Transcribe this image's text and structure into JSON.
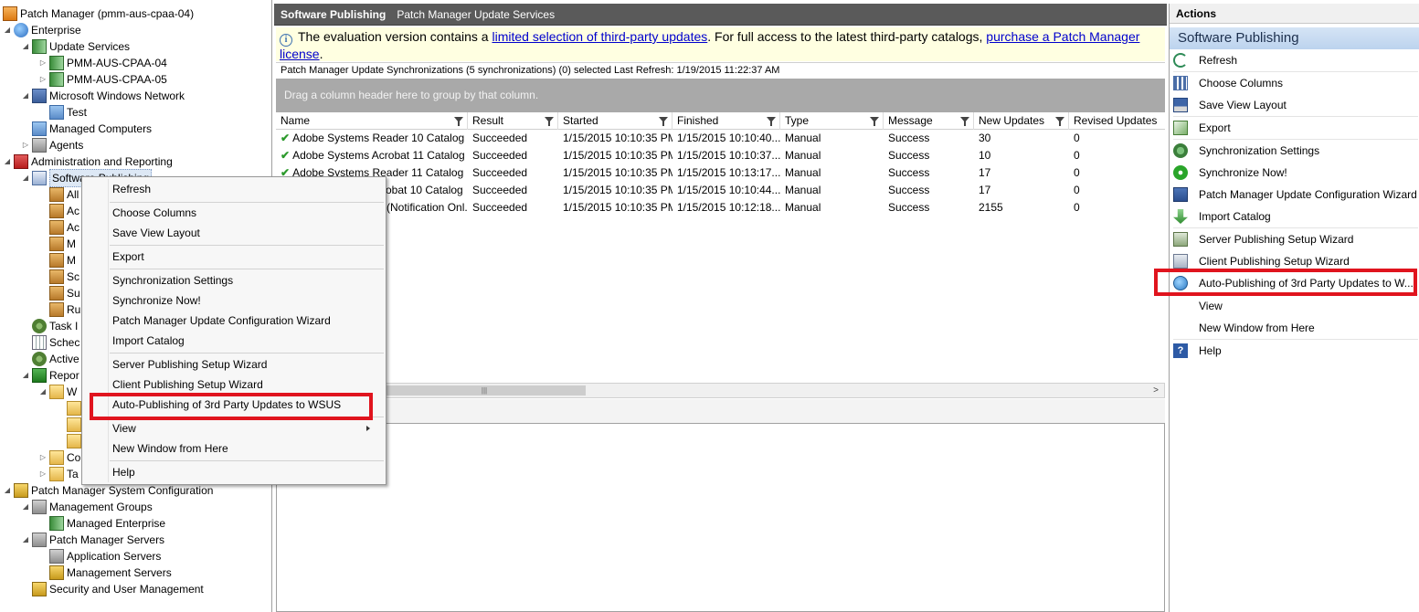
{
  "tree": {
    "items": [
      {
        "label": "Patch Manager (pmm-aus-cpaa-04)",
        "icon": "patch-manager-icon"
      },
      {
        "label": "Enterprise",
        "icon": "globe-icon"
      },
      {
        "label": "Update Services",
        "icon": "update-services-icon"
      },
      {
        "label": "PMM-AUS-CPAA-04",
        "icon": "server-icon"
      },
      {
        "label": "PMM-AUS-CPAA-05",
        "icon": "server-icon"
      },
      {
        "label": "Microsoft Windows Network",
        "icon": "network-icon"
      },
      {
        "label": "Test",
        "icon": "computers-icon"
      },
      {
        "label": "Managed Computers",
        "icon": "computers-icon"
      },
      {
        "label": "Agents",
        "icon": "agents-icon"
      },
      {
        "label": "Administration and Reporting",
        "icon": "toolbox-icon"
      },
      {
        "label": "Software Publishing",
        "icon": "publishing-icon"
      },
      {
        "label": "All",
        "icon": "package-icon"
      },
      {
        "label": "Ac",
        "icon": "package-icon"
      },
      {
        "label": "Ac",
        "icon": "package-icon"
      },
      {
        "label": "M",
        "icon": "package-icon"
      },
      {
        "label": "M",
        "icon": "package-icon"
      },
      {
        "label": "Sc",
        "icon": "package-icon"
      },
      {
        "label": "Su",
        "icon": "package-icon"
      },
      {
        "label": "Ru",
        "icon": "package-icon"
      },
      {
        "label": "Task I",
        "icon": "task-icon"
      },
      {
        "label": "Schec",
        "icon": "calendar-icon"
      },
      {
        "label": "Active",
        "icon": "gear-icon"
      },
      {
        "label": "Repor",
        "icon": "reports-icon"
      },
      {
        "label": "W",
        "icon": "folder-icon"
      },
      {
        "label": "",
        "icon": "report-icon"
      },
      {
        "label": "",
        "icon": "report-icon"
      },
      {
        "label": "",
        "icon": "report-icon"
      },
      {
        "label": "Co",
        "icon": "folder-icon"
      },
      {
        "label": "Ta",
        "icon": "folder-icon"
      },
      {
        "label": "Patch Manager System Configuration",
        "icon": "config-icon"
      },
      {
        "label": "Management Groups",
        "icon": "management-groups-icon"
      },
      {
        "label": "Managed Enterprise",
        "icon": "enterprise-icon"
      },
      {
        "label": "Patch Manager Servers",
        "icon": "servers-icon"
      },
      {
        "label": "Application Servers",
        "icon": "app-server-icon"
      },
      {
        "label": "Management Servers",
        "icon": "mgmt-server-icon"
      },
      {
        "label": "Security and User Management",
        "icon": "security-icon"
      }
    ]
  },
  "center": {
    "title": "Software Publishing",
    "subtitle": "Patch Manager Update Services",
    "banner": {
      "text1": "The evaluation version contains a ",
      "link1": "limited selection of third-party updates",
      "text2": ". For full access  to the latest third-party catalogs, ",
      "link2": "purchase a Patch Manager license",
      "text3": "."
    },
    "sync_bar": "Patch Manager Update Synchronizations (5 synchronizations)  (0) selected Last Refresh: 1/19/2015 11:22:37 AM",
    "group_hint": "Drag a column header here to group by that column.",
    "grid": {
      "columns": [
        "Name",
        "Result",
        "Started",
        "Finished",
        "Type",
        "Message",
        "New Updates",
        "Revised Updates"
      ],
      "rows": [
        [
          "Adobe Systems Reader 10 Catalog",
          "Succeeded",
          "1/15/2015 10:10:35 PM",
          "1/15/2015  10:10:40...",
          "Manual",
          "Success",
          "30",
          "0"
        ],
        [
          "Adobe Systems Acrobat 11 Catalog",
          "Succeeded",
          "1/15/2015 10:10:35 PM",
          "1/15/2015  10:10:37...",
          "Manual",
          "Success",
          "10",
          "0"
        ],
        [
          "Adobe Systems Reader 11 Catalog",
          "Succeeded",
          "1/15/2015 10:10:35 PM",
          "1/15/2015  10:13:17...",
          "Manual",
          "Success",
          "17",
          "0"
        ],
        [
          "obat 10 Catalog",
          "Succeeded",
          "1/15/2015 10:10:35 PM",
          "1/15/2015  10:10:44...",
          "Manual",
          "Success",
          "17",
          "0"
        ],
        [
          "(Notification Onl...",
          "Succeeded",
          "1/15/2015 10:10:35 PM",
          "1/15/2015  10:12:18...",
          "Manual",
          "Success",
          "2155",
          "0"
        ]
      ]
    }
  },
  "actions": {
    "header": "Actions",
    "section": "Software Publishing",
    "items": [
      {
        "label": "Refresh",
        "icon": "refresh-icon"
      },
      {
        "label": "Choose Columns",
        "icon": "columns-icon"
      },
      {
        "label": "Save View Layout",
        "icon": "save-icon"
      },
      {
        "label": "Export",
        "icon": "export-icon"
      },
      {
        "label": "Synchronization Settings",
        "icon": "sync-settings-icon"
      },
      {
        "label": "Synchronize Now!",
        "icon": "sync-now-icon"
      },
      {
        "label": "Patch Manager Update Configuration Wizard",
        "icon": "wizard-icon"
      },
      {
        "label": "Import Catalog",
        "icon": "import-icon"
      },
      {
        "label": "Server Publishing Setup Wizard",
        "icon": "server-wizard-icon"
      },
      {
        "label": "Client Publishing Setup Wizard",
        "icon": "client-wizard-icon"
      },
      {
        "label": "Auto-Publishing of 3rd Party Updates to W...",
        "icon": "auto-publish-icon"
      },
      {
        "label": "View",
        "icon": ""
      },
      {
        "label": "New Window from Here",
        "icon": ""
      },
      {
        "label": "Help",
        "icon": "help-icon"
      }
    ]
  },
  "context_menu": {
    "items": [
      {
        "label": "Refresh"
      },
      {
        "label": "Choose Columns"
      },
      {
        "label": "Save View Layout"
      },
      {
        "label": "Export"
      },
      {
        "label": "Synchronization Settings"
      },
      {
        "label": "Synchronize Now!"
      },
      {
        "label": "Patch Manager Update Configuration Wizard"
      },
      {
        "label": "Import Catalog"
      },
      {
        "label": "Server Publishing Setup Wizard"
      },
      {
        "label": "Client Publishing Setup Wizard"
      },
      {
        "label": "Auto-Publishing of 3rd Party Updates to WSUS"
      },
      {
        "label": "View"
      },
      {
        "label": "New Window from Here"
      },
      {
        "label": "Help"
      }
    ]
  },
  "colors": {
    "highlight": "#e0141e",
    "title_bar": "#5a5a5a",
    "banner_bg": "#ffffe1",
    "link": "#0000cc"
  }
}
